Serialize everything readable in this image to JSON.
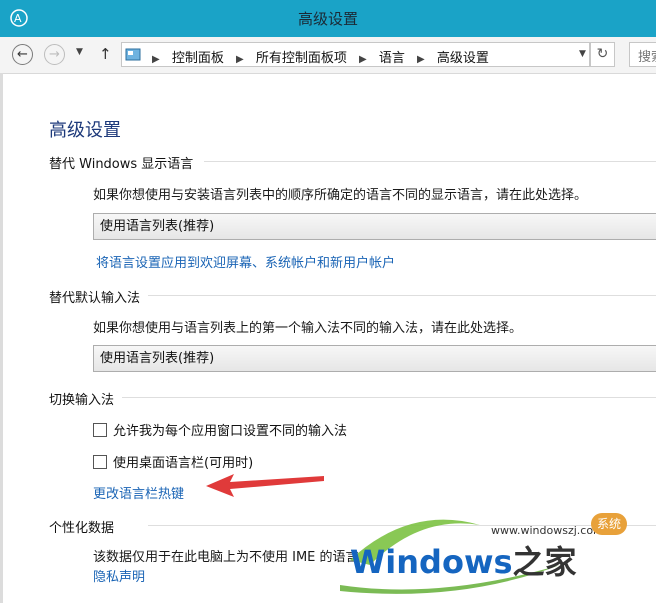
{
  "window": {
    "title": "高级设置"
  },
  "nav": {
    "back_icon": "back-arrow-icon",
    "forward_icon": "forward-arrow-icon",
    "breadcrumbs": [
      "控制面板",
      "所有控制面板项",
      "语言",
      "高级设置"
    ],
    "search_placeholder": "搜索"
  },
  "page": {
    "title": "高级设置"
  },
  "display_language": {
    "heading": "替代 Windows 显示语言",
    "description": "如果你想使用与安装语言列表中的顺序所确定的语言不同的显示语言，请在此处选择。",
    "dropdown_value": "使用语言列表(推荐)",
    "link": "将语言设置应用到欢迎屏幕、系统帐户和新用户帐户"
  },
  "input_method": {
    "heading": "替代默认输入法",
    "description": "如果你想使用与语言列表上的第一个输入法不同的输入法，请在此处选择。",
    "dropdown_value": "使用语言列表(推荐)"
  },
  "switch_input": {
    "heading": "切换输入法",
    "checkbox1": {
      "label": "允许我为每个应用窗口设置不同的输入法",
      "checked": false
    },
    "checkbox2": {
      "label": "使用桌面语言栏(可用时)",
      "checked": false
    },
    "link": "更改语言栏热键"
  },
  "personalization": {
    "heading": "个性化数据",
    "description": "该数据仅用于在此电脑上为不使用 IME 的语言",
    "link": "隐私声明"
  },
  "watermark": {
    "url": "www.windowszj.com",
    "badge": "系统",
    "brand": "Windows",
    "brand_cn": "之家"
  },
  "colors": {
    "titlebar": "#1aa3c7",
    "link": "#1a64b5",
    "arrow": "#e03a3a",
    "brand": "#1565c0"
  }
}
